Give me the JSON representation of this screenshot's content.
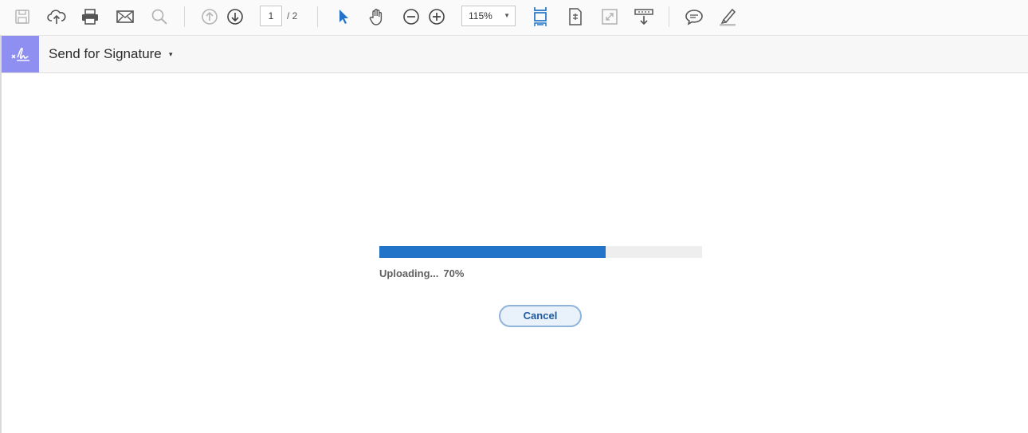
{
  "toolbar": {
    "page_current": "1",
    "page_total": "/ 2",
    "zoom": "115%",
    "icons": [
      "save-icon",
      "upload-cloud-icon",
      "print-icon",
      "email-icon",
      "search-icon",
      "prev-page-icon",
      "next-page-icon",
      "select-cursor-icon",
      "hand-tool-icon",
      "zoom-out-icon",
      "zoom-in-icon",
      "fit-page-icon",
      "rotate-page-icon",
      "fullscreen-icon",
      "read-mode-icon",
      "comment-icon",
      "highlight-icon"
    ]
  },
  "sigbar": {
    "title": "Send for Signature",
    "caret": "▾",
    "tile_color": "#8f8ff2"
  },
  "upload": {
    "status": "Uploading...",
    "percent_label": "70%",
    "progress": 0.7,
    "cancel_label": "Cancel",
    "bar_color": "#2174c8"
  }
}
